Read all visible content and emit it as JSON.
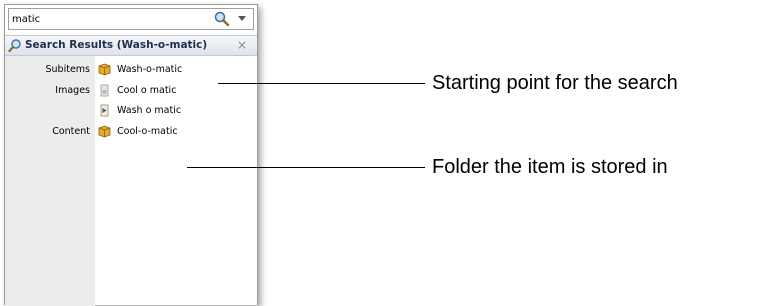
{
  "search": {
    "value": "matic",
    "button_icon": "magnifier-icon",
    "dropdown_icon": "dropdown-arrow-icon"
  },
  "results": {
    "title": "Search Results (Wash-o-matic)",
    "title_icon": "magnifier-icon",
    "close_label": "×",
    "groups": [
      {
        "label": "Subitems",
        "items": [
          {
            "name": "Wash-o-matic",
            "icon": "package-icon"
          }
        ]
      },
      {
        "label": "Images",
        "items": [
          {
            "name": "Cool o matic",
            "icon": "image-file-icon"
          },
          {
            "name": "Wash o matic",
            "icon": "image-file-icon"
          }
        ]
      },
      {
        "label": "Content",
        "items": [
          {
            "name": "Cool-o-matic",
            "icon": "package-icon"
          }
        ]
      }
    ]
  },
  "callouts": [
    {
      "text": "Starting point for the search"
    },
    {
      "text": "Folder the item is stored in"
    }
  ],
  "colors": {
    "label_column": "#ececec",
    "header": "#dfe4ea",
    "package": "#d9a520"
  }
}
